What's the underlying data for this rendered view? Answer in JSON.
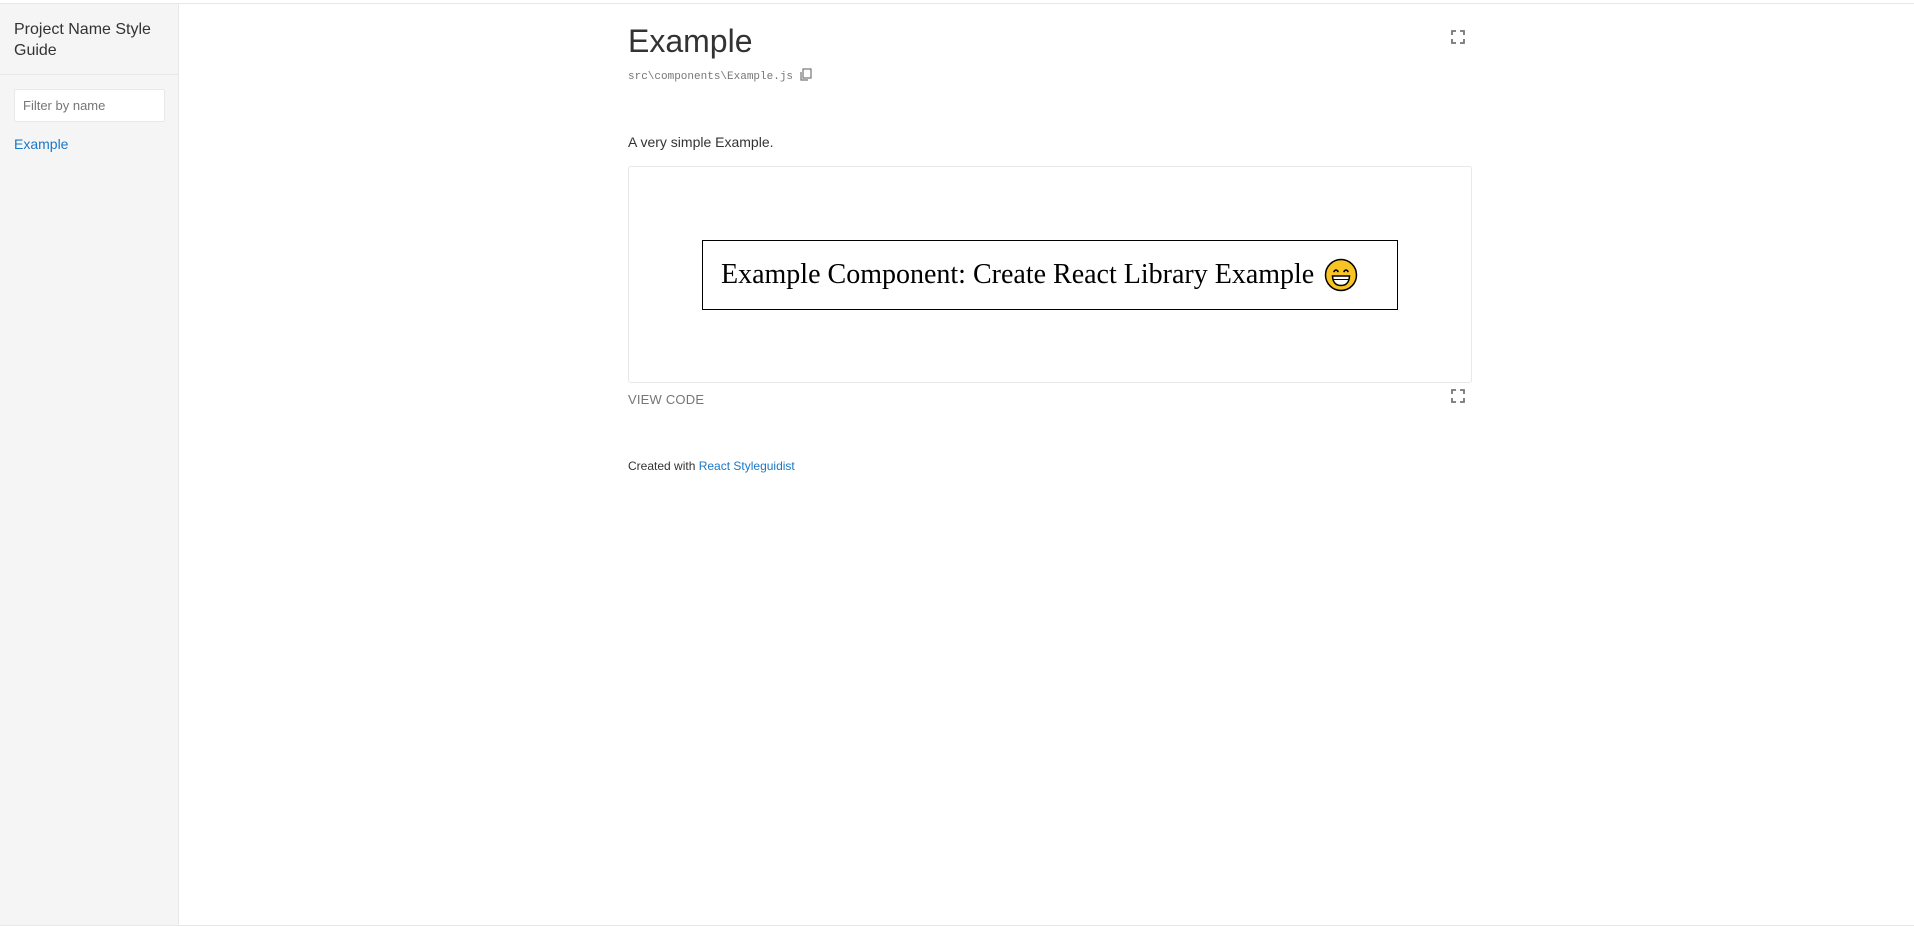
{
  "sidebar": {
    "title": "Project Name Style Guide",
    "filter": {
      "placeholder": "Filter by name",
      "value": ""
    },
    "items": [
      {
        "label": "Example"
      }
    ]
  },
  "main": {
    "title": "Example",
    "path": "src\\components\\Example.js",
    "description": "A very simple Example.",
    "preview": {
      "text": "Example Component: Create React Library Example",
      "emoji": "grinning-face-icon"
    },
    "view_code_label": "VIEW CODE"
  },
  "footer": {
    "prefix": "Created with",
    "link_label": "React Styleguidist"
  },
  "colors": {
    "link": "#1978c8",
    "muted": "#767676",
    "border": "#e8e8e8",
    "sidebar_bg": "#f5f5f5",
    "emoji_yellow": "#f7c325"
  }
}
